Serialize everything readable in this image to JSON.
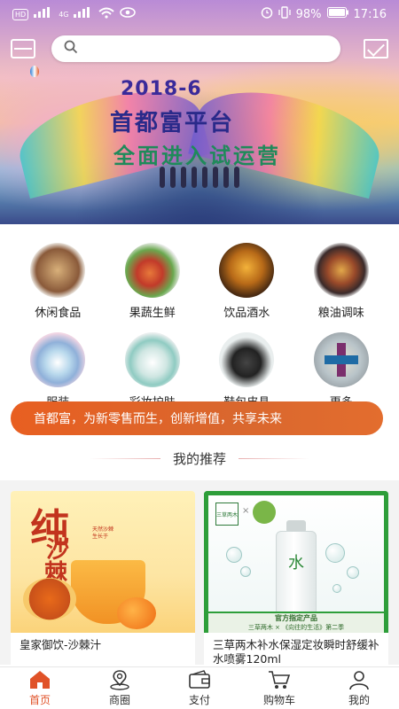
{
  "status_bar": {
    "left_badges": [
      "HD",
      "4G",
      "4G"
    ],
    "battery": "98%",
    "time": "17:16"
  },
  "banner": {
    "year": "2018-6",
    "title": "首都富平台",
    "subtitle": "全面进入试运营"
  },
  "search": {
    "placeholder": ""
  },
  "categories": [
    {
      "label": "休闲食品"
    },
    {
      "label": "果蔬生鲜"
    },
    {
      "label": "饮品酒水"
    },
    {
      "label": "粮油调味"
    },
    {
      "label": "服装"
    },
    {
      "label": "彩妆护肤"
    },
    {
      "label": "鞋包皮具"
    },
    {
      "label": "更多"
    }
  ],
  "slogan": "首都富，为新零售而生，创新增值，共享未来",
  "recommend": {
    "title": "我的推荐",
    "products": [
      {
        "title": "皇家御饮-沙棘汁",
        "image_text": {
          "big1": "纯",
          "big2": "沙",
          "big3": "棘",
          "note": "天然沙棘 生长于"
        }
      },
      {
        "title": "三草两木补水保湿定妆瞬时舒缓补水喷雾120ml",
        "image_text": {
          "logo": "三草两木",
          "mark": "水",
          "ribbon_top": "官方指定产品",
          "ribbon_bottom": "三草两木 × 《向往的生活》第二季"
        }
      }
    ]
  },
  "tabbar": {
    "tabs": [
      {
        "label": "首页",
        "active": true
      },
      {
        "label": "商圈",
        "active": false
      },
      {
        "label": "支付",
        "active": false
      },
      {
        "label": "购物车",
        "active": false
      },
      {
        "label": "我的",
        "active": false
      }
    ]
  },
  "colors": {
    "accent": "#e05228",
    "slogan_bg": "#e3682c",
    "section_bg": "#f3f3f3"
  }
}
